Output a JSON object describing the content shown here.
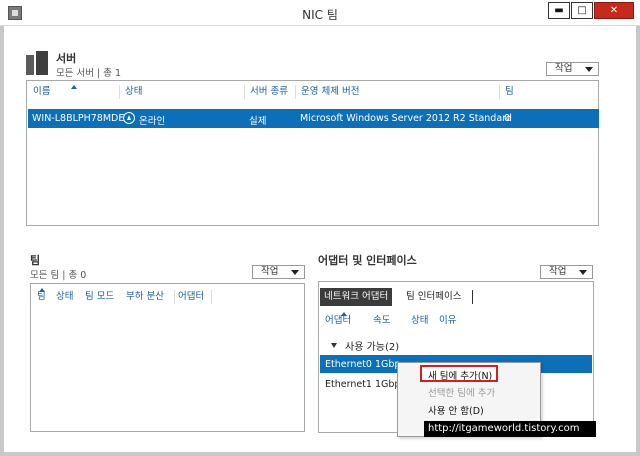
{
  "window": {
    "title": "NIC 팀",
    "minimize": "▬",
    "maximize": "□",
    "close": "✕"
  },
  "servers": {
    "title": "서버",
    "subtitle": "모든 서버 | 총 1",
    "task": "작업",
    "columns": [
      "이름",
      "상태",
      "서버 종류",
      "운영 체제 버전",
      "팀"
    ],
    "rows": [
      {
        "name": "WIN-L8BLPH78MDE",
        "status": "온라인",
        "type": "실제",
        "os": "Microsoft Windows Server 2012 R2 Standard",
        "team": "0"
      }
    ]
  },
  "teams": {
    "title": "팀",
    "subtitle": "모든 팀 | 총 0",
    "task": "작업",
    "columns": [
      "팀",
      "상태",
      "팀 모드",
      "부하 분산",
      "어댑터"
    ]
  },
  "adapters": {
    "title": "어댑터 및 인터페이스",
    "task": "작업",
    "tabs": [
      "네트워크 어댑터",
      "팀 인터페이스"
    ],
    "columns": [
      "어댑터",
      "속도",
      "상태",
      "이유"
    ],
    "group": "사용 가능(2)",
    "rows": [
      {
        "name": "Ethernet0",
        "speed": "1Gbp"
      },
      {
        "name": "Ethernet1",
        "speed": "1Gbp"
      }
    ]
  },
  "context_menu": {
    "items": [
      "새 팀에 추가(N)",
      "선택한 팀에 추가",
      "사용 안 함(D)"
    ]
  },
  "watermark": "http://itgameworld.tistory.com"
}
